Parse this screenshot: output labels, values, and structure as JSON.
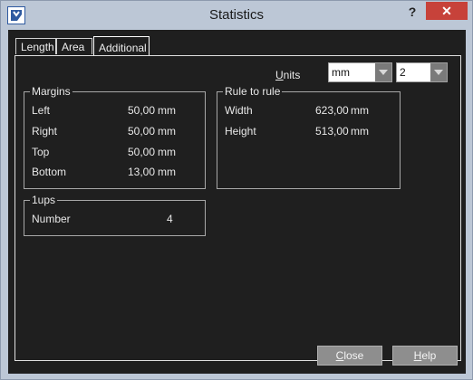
{
  "window": {
    "title": "Statistics",
    "help_label": "?",
    "close_label": "✕"
  },
  "tabs": [
    {
      "label": "Length",
      "active": false
    },
    {
      "label": "Area",
      "active": false
    },
    {
      "label": "Additional",
      "active": true
    }
  ],
  "units": {
    "label_first": "U",
    "label_rest": "nits",
    "unit_value": "mm",
    "decimals_value": "2"
  },
  "margins": {
    "title": "Margins",
    "rows": [
      {
        "label": "Left",
        "value": "50,00",
        "unit": "mm"
      },
      {
        "label": "Right",
        "value": "50,00",
        "unit": "mm"
      },
      {
        "label": "Top",
        "value": "50,00",
        "unit": "mm"
      },
      {
        "label": "Bottom",
        "value": "13,00",
        "unit": "mm"
      }
    ]
  },
  "rule_to_rule": {
    "title": "Rule to rule",
    "rows": [
      {
        "label": "Width",
        "value": "623,00",
        "unit": "mm"
      },
      {
        "label": "Height",
        "value": "513,00",
        "unit": "mm"
      }
    ]
  },
  "ups": {
    "title": "1ups",
    "rows": [
      {
        "label": "Number",
        "value": "4"
      }
    ]
  },
  "buttons": {
    "close_first": "C",
    "close_rest": "lose",
    "help_first": "H",
    "help_rest": "elp"
  },
  "colors": {
    "client_bg": "#1f1f1f",
    "chrome": "#bcc7d6",
    "close_red": "#c7423a"
  }
}
